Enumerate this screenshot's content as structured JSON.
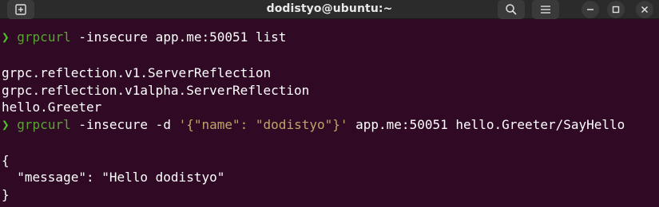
{
  "window": {
    "title": "dodistyo@ubuntu:~"
  },
  "titlebar": {
    "new_tab_icon": "new-tab-icon",
    "search_icon": "search-icon",
    "menu_icon": "hamburger-menu-icon",
    "minimize_icon": "minimize-icon",
    "maximize_icon": "maximize-icon",
    "close_icon": "close-icon"
  },
  "terminal": {
    "prompt_symbol": "❯",
    "command1": {
      "program": "grpcurl",
      "args": " -insecure app.me:50051 list"
    },
    "output1": [
      "grpc.reflection.v1.ServerReflection",
      "grpc.reflection.v1alpha.ServerReflection",
      "hello.Greeter"
    ],
    "command2": {
      "program": "grpcurl",
      "flags": " -insecure -d ",
      "data_arg": "'{\"name\": \"dodistyo\"}'",
      "rest": " app.me:50051 hello.Greeter/SayHello"
    },
    "output2": [
      "{",
      "  \"message\": \"Hello dodistyo\"",
      "}"
    ]
  },
  "colors": {
    "background": "#300a24",
    "prompt": "#4fc22a",
    "command": "#5aa335",
    "string": "#c2a36a",
    "text": "#ffffff"
  }
}
